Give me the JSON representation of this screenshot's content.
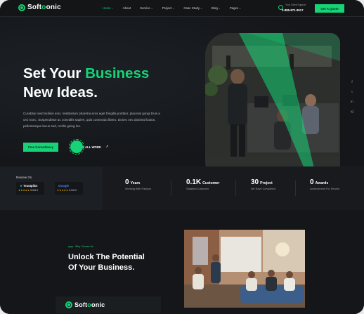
{
  "header": {
    "logo_text_1": "Soft",
    "logo_text_2": "o",
    "logo_text_3": "onic",
    "nav": [
      {
        "label": "Home",
        "caret": true,
        "active": true
      },
      {
        "label": "About",
        "caret": false
      },
      {
        "label": "Service",
        "caret": true
      },
      {
        "label": "Project",
        "caret": true
      },
      {
        "label": "Case Study",
        "caret": true
      },
      {
        "label": "Blog",
        "caret": true
      },
      {
        "label": "Pages",
        "caret": true
      }
    ],
    "support_label": "Your Client Support",
    "support_phone": "2-885-871-9517",
    "cta_label": "Get A Quote"
  },
  "hero": {
    "title_1": "Set Your ",
    "title_highlight": "Business",
    "title_2": "New Ideas.",
    "description": "Curabitur sed facilisis erat. Vestibulum pharetra eros eget fringilla porttitor. placerat gongi Duis a orci nunc. Suspendisse ac convallis sapien, quis commodo libero. Donec nec dosimal luctus, pellentesque lacus sed, mollis going leo.",
    "primary_button": "Free Consultancy",
    "secondary_button": "VIEW ALL WORK",
    "social": [
      "f",
      "t",
      "in",
      "ig"
    ]
  },
  "reviews": {
    "title": "Review On",
    "items": [
      {
        "name": "Trustpilot",
        "stars": "★★★★★",
        "score": "5.0/5.0",
        "color": "#00b67a"
      },
      {
        "name": "Google",
        "stars": "★★★★★",
        "score": "5.0/5.0",
        "color": "#4285f4"
      }
    ]
  },
  "stats": [
    {
      "value": "0",
      "unit": "Years",
      "label": "Working With Passion"
    },
    {
      "value": "0.1K",
      "unit": "Customer",
      "label": "Satisfied Customer"
    },
    {
      "value": "30",
      "unit": "Project",
      "label": "We Have Completed"
    },
    {
      "value": "0",
      "unit": "Awards",
      "label": "Achievement For Service"
    }
  ],
  "about": {
    "eyebrow": "Why Choose Us",
    "title_1": "Unlock The Potential",
    "title_2": "Of Your Business."
  },
  "colors": {
    "accent": "#16d377",
    "background": "#16181b"
  }
}
